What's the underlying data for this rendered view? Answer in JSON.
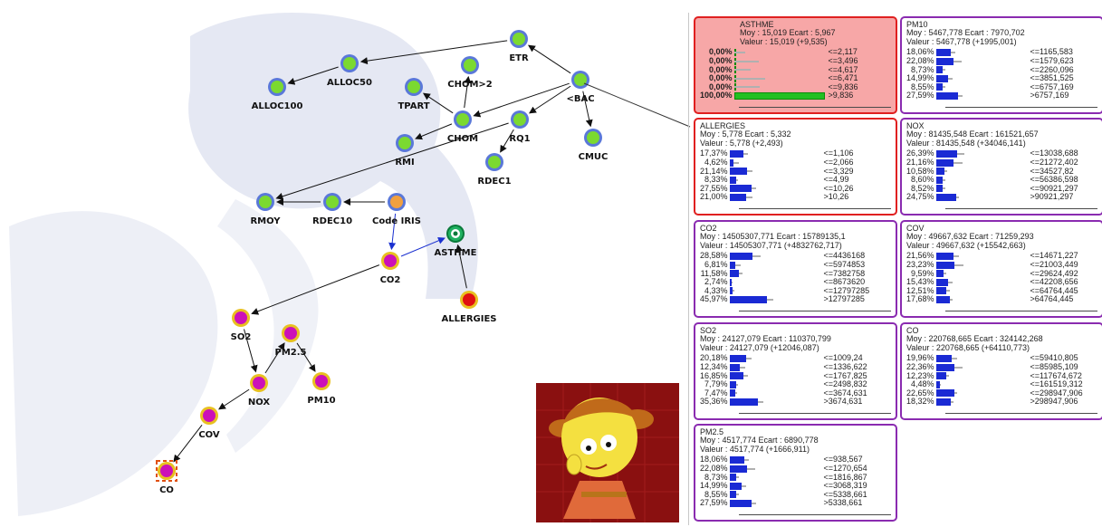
{
  "colors": {
    "node_green": "#7bd930",
    "node_magenta": "#cc10b8",
    "node_orange": "#f0a040",
    "node_red": "#e01010",
    "node_ring_blue": "#5a78d8",
    "node_ring_yellow": "#e8c020",
    "card_red_border": "#e02020",
    "card_purple_border": "#8a2bb0",
    "bar_blue": "#1a2ad4",
    "observed_bg": "#f7a7a7",
    "observed_bar": "#22c022"
  },
  "graph": {
    "nodes": [
      {
        "id": "alloc100",
        "label": "ALLOC100",
        "style": "green-blue"
      },
      {
        "id": "alloc50",
        "label": "ALLOC50",
        "style": "green-blue"
      },
      {
        "id": "etr",
        "label": "ETR",
        "style": "green-blue"
      },
      {
        "id": "chom2",
        "label": "CHOM>2",
        "style": "green-blue"
      },
      {
        "id": "tpart",
        "label": "TPART",
        "style": "green-blue"
      },
      {
        "id": "bac",
        "label": "<BAC",
        "style": "green-blue"
      },
      {
        "id": "chom",
        "label": "CHOM",
        "style": "green-blue"
      },
      {
        "id": "rq1",
        "label": "RQ1",
        "style": "green-blue"
      },
      {
        "id": "cmuc",
        "label": "CMUC",
        "style": "green-blue"
      },
      {
        "id": "rmi",
        "label": "RMI",
        "style": "green-blue"
      },
      {
        "id": "rdec1",
        "label": "RDEC1",
        "style": "green-blue"
      },
      {
        "id": "rmoy",
        "label": "RMOY",
        "style": "green-blue"
      },
      {
        "id": "rdec10",
        "label": "RDEC10",
        "style": "green-blue"
      },
      {
        "id": "codeiris",
        "label": "Code IRIS",
        "style": "orange-blue"
      },
      {
        "id": "asthme",
        "label": "ASTHME",
        "style": "target"
      },
      {
        "id": "co2",
        "label": "CO2",
        "style": "magenta-yellow"
      },
      {
        "id": "allergies",
        "label": "ALLERGIES",
        "style": "red-yellow"
      },
      {
        "id": "so2",
        "label": "SO2",
        "style": "magenta-yellow"
      },
      {
        "id": "pm25",
        "label": "PM2.5",
        "style": "magenta-yellow"
      },
      {
        "id": "nox",
        "label": "NOX",
        "style": "magenta-yellow"
      },
      {
        "id": "pm10",
        "label": "PM10",
        "style": "magenta-yellow"
      },
      {
        "id": "cov",
        "label": "COV",
        "style": "magenta-yellow"
      },
      {
        "id": "co",
        "label": "CO",
        "style": "magenta-square"
      }
    ]
  },
  "monitors": [
    {
      "id": "asthme",
      "observed": true,
      "border": "red",
      "title": "ASTHME",
      "stats": "Moy : 15,019 Ecart : 5,967",
      "value": "Valeur : 15,019 (+9,535)",
      "rows": [
        [
          "0,00%",
          "<=2,117"
        ],
        [
          "0,00%",
          "<=3,496"
        ],
        [
          "0,00%",
          "<=4,617"
        ],
        [
          "0,00%",
          "<=6,471"
        ],
        [
          "0,00%",
          "<=9,836"
        ],
        [
          "100,00%",
          ">9,836"
        ]
      ],
      "bars": [
        0,
        0,
        0,
        0,
        0,
        100
      ],
      "ghost": [
        20,
        46,
        30,
        58,
        48,
        0
      ],
      "note": "observed"
    },
    {
      "id": "pm10",
      "border": "purple",
      "title": "PM10",
      "stats": "Moy : 5467,778 Ecart : 7970,702",
      "value": "Valeur : 5467,778 (+1995,001)",
      "rows": [
        [
          "18,06%",
          "<=1165,583"
        ],
        [
          "22,08%",
          "<=1579,623"
        ],
        [
          "8,73%",
          "<=2260,096"
        ],
        [
          "14,99%",
          "<=3851,525"
        ],
        [
          "8,55%",
          "<=6757,169"
        ],
        [
          "27,59%",
          ">6757,169"
        ]
      ],
      "bars": [
        18.06,
        22.08,
        8.73,
        14.99,
        8.55,
        27.59
      ],
      "ghost": [
        18,
        30,
        9,
        15,
        9,
        14
      ]
    },
    {
      "id": "allergies",
      "border": "red",
      "title": "ALLERGIES",
      "stats": "Moy : 5,778 Ecart : 5,332",
      "value": "Valeur : 5,778 (+2,493)",
      "rows": [
        [
          "17,37%",
          "<=1,106"
        ],
        [
          "4,62%",
          "<=2,066"
        ],
        [
          "21,14%",
          "<=3,329"
        ],
        [
          "8,33%",
          "<=4,99"
        ],
        [
          "27,55%",
          "<=10,26"
        ],
        [
          "21,00%",
          ">10,26"
        ]
      ],
      "bars": [
        17.37,
        4.62,
        21.14,
        8.33,
        27.55,
        21.0
      ],
      "ghost": [
        17,
        20,
        21,
        8,
        14,
        21
      ]
    },
    {
      "id": "nox",
      "border": "purple",
      "title": "NOX",
      "stats": "Moy : 81435,548 Ecart : 161521,657",
      "value": "Valeur : 81435,548 (+34046,141)",
      "rows": [
        [
          "26,39%",
          "<=13038,688"
        ],
        [
          "21,16%",
          "<=21272,402"
        ],
        [
          "10,58%",
          "<=34527,82"
        ],
        [
          "8,60%",
          "<=56386,598"
        ],
        [
          "8,52%",
          "<=90921,297"
        ],
        [
          "24,75%",
          ">90921,297"
        ]
      ],
      "bars": [
        26.39,
        21.16,
        10.58,
        8.6,
        8.52,
        24.75
      ],
      "ghost": [
        26,
        34,
        11,
        9,
        9,
        12
      ]
    },
    {
      "id": "co2",
      "border": "purple",
      "title": "CO2",
      "stats": "Moy : 14505307,771 Ecart : 15789135,1",
      "value": "Valeur : 14505307,771 (+4832762,717)",
      "rows": [
        [
          "28,58%",
          "<=4436168"
        ],
        [
          "6,81%",
          "<=5974853"
        ],
        [
          "11,58%",
          "<=7382758"
        ],
        [
          "2,74%",
          "<=8673620"
        ],
        [
          "4,33%",
          "<=12797285"
        ],
        [
          "45,97%",
          ">12797285"
        ]
      ],
      "bars": [
        28.58,
        6.81,
        11.58,
        2.74,
        4.33,
        45.97
      ],
      "ghost": [
        28,
        20,
        12,
        3,
        4,
        23
      ]
    },
    {
      "id": "cov",
      "border": "purple",
      "title": "COV",
      "stats": "Moy : 49667,632 Ecart : 71259,293",
      "value": "Valeur : 49667,632 (+15542,663)",
      "rows": [
        [
          "21,56%",
          "<=14671,227"
        ],
        [
          "23,23%",
          "<=21003,449"
        ],
        [
          "9,59%",
          "<=29624,492"
        ],
        [
          "15,43%",
          "<=42208,656"
        ],
        [
          "12,51%",
          "<=64764,445"
        ],
        [
          "17,68%",
          ">64764,445"
        ]
      ],
      "bars": [
        21.56,
        23.23,
        9.59,
        15.43,
        12.51,
        17.68
      ],
      "ghost": [
        21,
        31,
        10,
        15,
        13,
        9
      ]
    },
    {
      "id": "so2",
      "border": "purple",
      "title": "SO2",
      "stats": "Moy : 24127,079 Ecart : 110370,799",
      "value": "Valeur : 24127,079 (+12046,087)",
      "rows": [
        [
          "20,18%",
          "<=1009,24"
        ],
        [
          "12,34%",
          "<=1336,622"
        ],
        [
          "16,85%",
          "<=1767,825"
        ],
        [
          "7,79%",
          "<=2498,832"
        ],
        [
          "7,47%",
          "<=3674,631"
        ],
        [
          "35,36%",
          ">3674,631"
        ]
      ],
      "bars": [
        20.18,
        12.34,
        16.85,
        7.79,
        7.47,
        35.36
      ],
      "ghost": [
        20,
        22,
        17,
        8,
        7,
        18
      ]
    },
    {
      "id": "co",
      "border": "purple",
      "title": "CO",
      "stats": "Moy : 220768,665 Ecart : 324142,268",
      "value": "Valeur : 220768,665 (+64110,773)",
      "rows": [
        [
          "19,96%",
          "<=59410,805"
        ],
        [
          "22,36%",
          "<=85985,109"
        ],
        [
          "12,23%",
          "<=117674,672"
        ],
        [
          "4,48%",
          "<=161519,312"
        ],
        [
          "22,65%",
          "<=298947,906"
        ],
        [
          "18,32%",
          ">298947,906"
        ]
      ],
      "bars": [
        19.96,
        22.36,
        12.23,
        4.48,
        22.65,
        18.32
      ],
      "ghost": [
        20,
        30,
        12,
        4,
        11,
        9
      ]
    },
    {
      "id": "pm25",
      "border": "purple",
      "title": "PM2.5",
      "stats": "Moy : 4517,774 Ecart : 6890,778",
      "value": "Valeur : 4517,774 (+1666,911)",
      "rows": [
        [
          "18,06%",
          "<=938,567"
        ],
        [
          "22,08%",
          "<=1270,654"
        ],
        [
          "8,73%",
          "<=1816,867"
        ],
        [
          "14,99%",
          "<=3068,319"
        ],
        [
          "8,55%",
          "<=5338,661"
        ],
        [
          "27,59%",
          ">5338,661"
        ]
      ],
      "bars": [
        18.06,
        22.08,
        8.73,
        14.99,
        8.55,
        27.59
      ],
      "ghost": [
        18,
        30,
        9,
        15,
        9,
        14
      ]
    }
  ]
}
